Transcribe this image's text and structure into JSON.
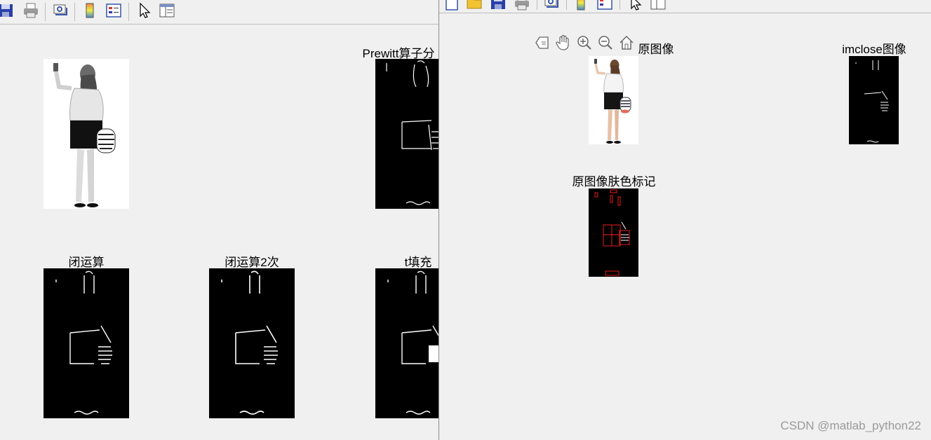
{
  "left_window": {
    "toolbar_icons": [
      "save-icon",
      "print-icon",
      "link-plot-icon",
      "colorbar-icon",
      "legend-icon",
      "pointer-icon",
      "plot-browser-icon"
    ],
    "axes": [
      {
        "id": "original",
        "title": ""
      },
      {
        "id": "prewitt",
        "title": "Prewitt算子分"
      },
      {
        "id": "close",
        "title": "闭运算"
      },
      {
        "id": "close2",
        "title": "闭运算2次"
      },
      {
        "id": "fill",
        "title": "t填充"
      }
    ]
  },
  "right_window": {
    "toolbar_icons": [
      "new-figure-icon",
      "open-icon",
      "save-icon",
      "print-icon",
      "link-plot-icon",
      "colorbar-icon",
      "legend-icon",
      "pointer-icon",
      "plot-browser-icon"
    ],
    "axes_toolbar_icons": [
      "export-icon",
      "pan-icon",
      "zoom-in-icon",
      "zoom-out-icon",
      "home-icon"
    ],
    "axes": [
      {
        "id": "orig",
        "title": "原图像"
      },
      {
        "id": "imclose",
        "title": "imclose图像"
      },
      {
        "id": "skin",
        "title": "原图像肤色标记"
      }
    ]
  },
  "watermark": "CSDN @matlab_python22",
  "colors": {
    "background": "#f0f0f0",
    "image_bg": "#000000",
    "skin_mark": "#ff2020"
  }
}
